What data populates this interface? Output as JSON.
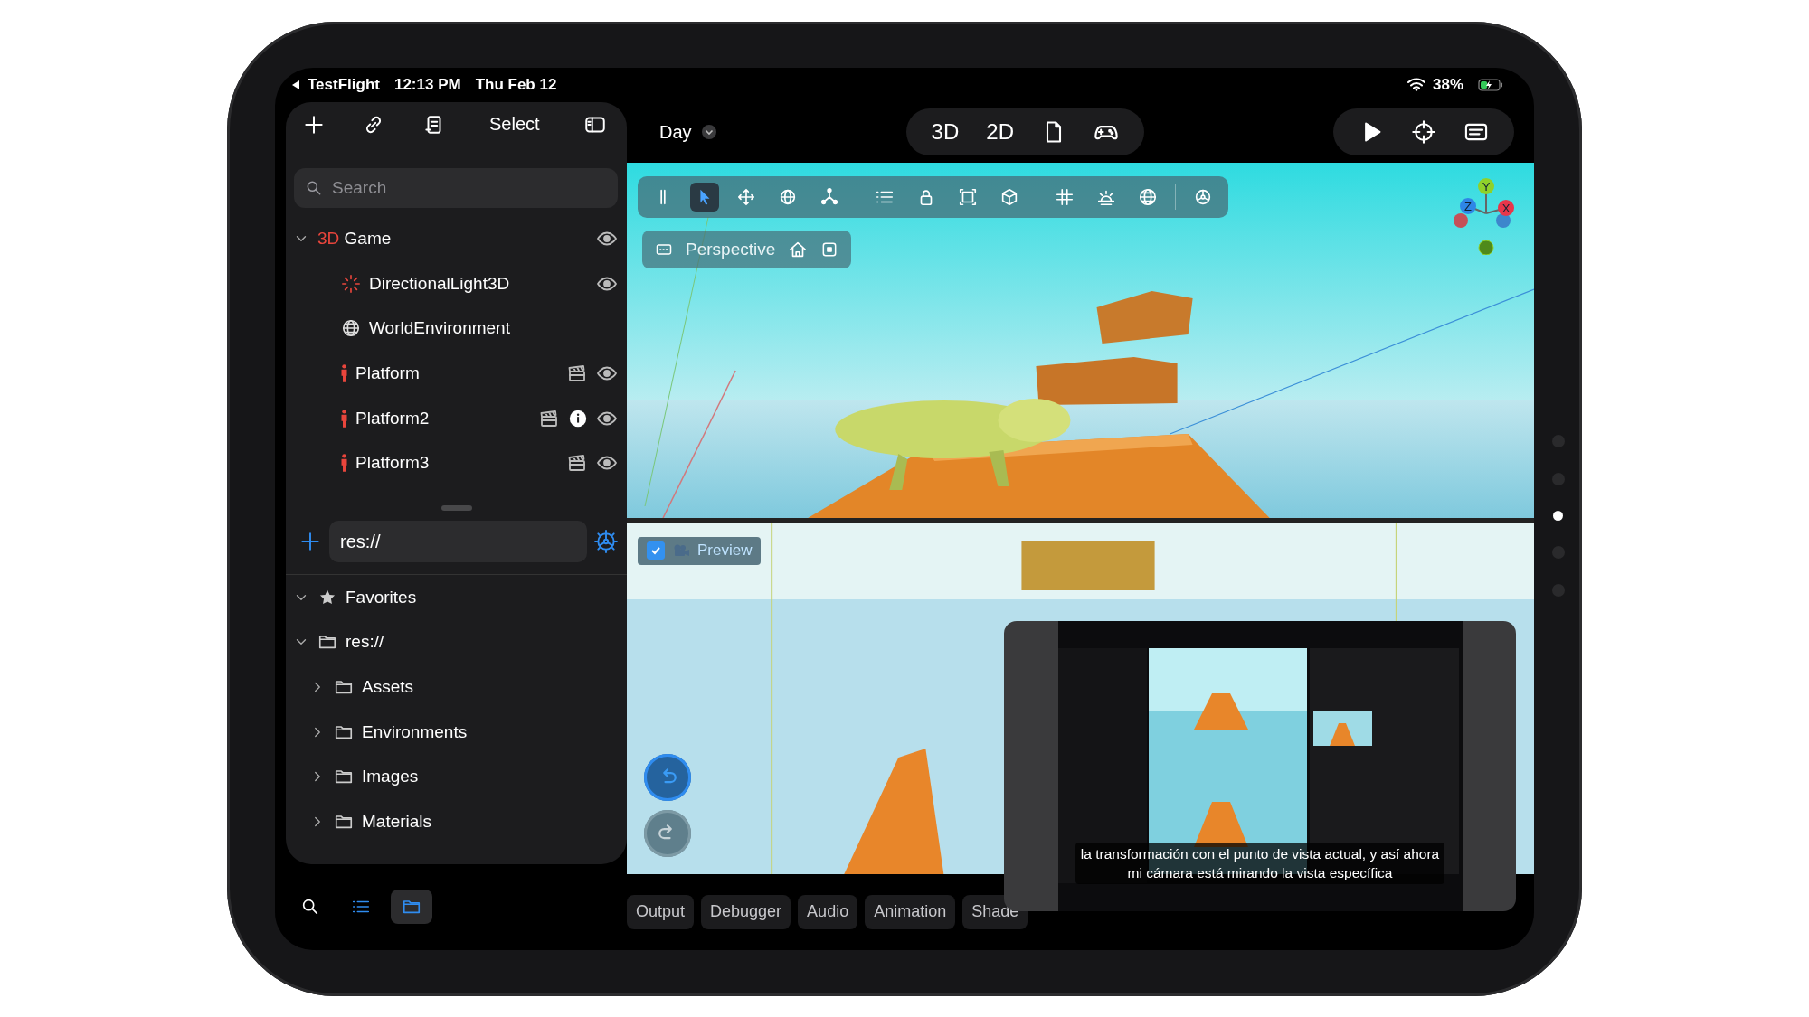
{
  "status_bar": {
    "back_app": "TestFlight",
    "time": "12:13 PM",
    "date": "Thu Feb 12",
    "battery": "38%"
  },
  "sidebar": {
    "toolbar": [
      {
        "kind": "plus"
      },
      {
        "kind": "link"
      },
      {
        "kind": "scroll"
      },
      {
        "kind": "text",
        "label": "Select"
      },
      {
        "kind": "sidebar"
      }
    ],
    "search": {
      "placeholder": "Search"
    },
    "scene_tree": [
      {
        "prefix": "3D",
        "name": "Game",
        "expanded": true,
        "eye": true,
        "scene": false,
        "info": false,
        "children": [
          {
            "name": "DirectionalLight3D",
            "kind": "light",
            "eye": true,
            "scene": false,
            "info": false
          },
          {
            "name": "WorldEnvironment",
            "kind": "globe",
            "eye": false,
            "scene": false,
            "info": false
          },
          {
            "name": "Platform",
            "kind": "person",
            "eye": true,
            "scene": true,
            "info": false
          },
          {
            "name": "Platform2",
            "kind": "person",
            "eye": true,
            "scene": true,
            "info": true
          },
          {
            "name": "Platform3",
            "kind": "person",
            "eye": true,
            "scene": true,
            "info": false
          }
        ]
      }
    ],
    "path_field": {
      "value": "res://"
    },
    "files": [
      {
        "name": "Favorites",
        "kind": "star",
        "expanded": true
      },
      {
        "name": "res://",
        "kind": "folder",
        "expanded": true,
        "children": [
          {
            "name": "Assets",
            "kind": "folder",
            "expanded": false
          },
          {
            "name": "Environments",
            "kind": "folder",
            "expanded": false
          },
          {
            "name": "Images",
            "kind": "folder",
            "expanded": false
          },
          {
            "name": "Materials",
            "kind": "folder",
            "expanded": false
          }
        ]
      }
    ]
  },
  "bottom_buttons": [
    {
      "kind": "search",
      "selected": false
    },
    {
      "kind": "list",
      "selected": false
    },
    {
      "kind": "folder",
      "selected": true
    }
  ],
  "top_bar": {
    "scene": "Day",
    "modes": [
      {
        "kind": "text",
        "label": "3D"
      },
      {
        "kind": "text",
        "label": "2D"
      },
      {
        "kind": "doc"
      },
      {
        "kind": "gamepad"
      }
    ],
    "actions": [
      {
        "kind": "play"
      },
      {
        "kind": "crosshair"
      },
      {
        "kind": "panel"
      }
    ]
  },
  "viewport": {
    "tools": [
      {
        "kind": "grip",
        "selected": false,
        "divider_before": false
      },
      {
        "kind": "select",
        "selected": true,
        "divider_before": false
      },
      {
        "kind": "move",
        "selected": false,
        "divider_before": false
      },
      {
        "kind": "rotate",
        "selected": false,
        "divider_before": false
      },
      {
        "kind": "scale",
        "selected": false,
        "divider_before": false
      },
      {
        "kind": "list",
        "selected": false,
        "divider_before": true
      },
      {
        "kind": "lock",
        "selected": false,
        "divider_before": false
      },
      {
        "kind": "frame",
        "selected": false,
        "divider_before": false
      },
      {
        "kind": "cube",
        "selected": false,
        "divider_before": false
      },
      {
        "kind": "grid",
        "selected": false,
        "divider_before": true
      },
      {
        "kind": "sun",
        "selected": false,
        "divider_before": false
      },
      {
        "kind": "globe",
        "selected": false,
        "divider_before": false
      },
      {
        "kind": "gear",
        "selected": false,
        "divider_before": true
      }
    ],
    "view_label": "Perspective",
    "gizmo": [
      {
        "label": "Y",
        "color": "#8fd12a"
      },
      {
        "label": "Z",
        "color": "#2e86e6"
      },
      {
        "label": "X",
        "color": "#e8364a"
      }
    ],
    "preview": {
      "label": "Preview",
      "checked": true
    }
  },
  "bottom_tabs": [
    {
      "label": "Output",
      "selected": false
    },
    {
      "label": "Debugger",
      "selected": false
    },
    {
      "label": "Audio",
      "selected": false
    },
    {
      "label": "Animation",
      "selected": false
    },
    {
      "label": "Shade",
      "selected": false
    }
  ],
  "video_overlay": {
    "kind": "picture",
    "subtitle": [
      "la transformación con el punto de vista actual, y así ahora",
      "mi cámara está mirando la vista específica"
    ]
  }
}
